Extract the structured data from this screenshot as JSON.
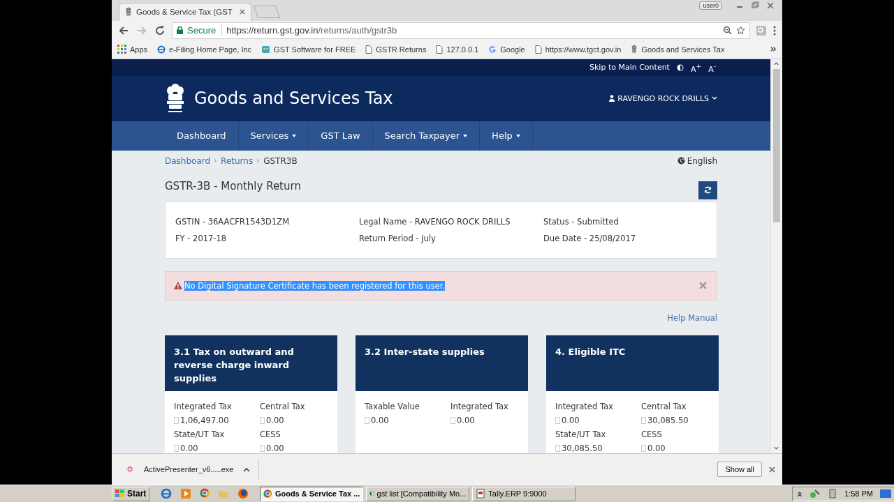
{
  "browser": {
    "tabs": [
      {
        "title": "Goods & Service Tax (GST",
        "selected": true
      }
    ],
    "profile": "user0",
    "url": {
      "secure_label": "Secure",
      "host": "https://return.gst.gov.in",
      "path": "/returns/auth/gstr3b"
    },
    "bookmarks": [
      {
        "label": "Apps",
        "kind": "apps"
      },
      {
        "label": "e-Filing Home Page, Inc",
        "kind": "ie"
      },
      {
        "label": "GST Software for FREE",
        "kind": "app"
      },
      {
        "label": "GSTR Returns",
        "kind": "page"
      },
      {
        "label": "127.0.0.1",
        "kind": "page"
      },
      {
        "label": "Google",
        "kind": "google"
      },
      {
        "label": "https://www.tgct.gov.in",
        "kind": "page"
      },
      {
        "label": "Goods and Services Tax",
        "kind": "emblem"
      }
    ]
  },
  "page": {
    "skip_link": "Skip to Main Content",
    "font_controls": [
      "A$^{+}$",
      "A$^{-}$"
    ],
    "site_title": "Goods and Services Tax",
    "user": "RAVENGO ROCK DRILLS",
    "nav": [
      {
        "label": "Dashboard",
        "dropdown": false
      },
      {
        "label": "Services",
        "dropdown": true
      },
      {
        "label": "GST Law",
        "dropdown": false
      },
      {
        "label": "Search Taxpayer",
        "dropdown": true
      },
      {
        "label": "Help",
        "dropdown": true
      }
    ],
    "breadcrumbs": [
      "Dashboard",
      "Returns",
      "GSTR3B"
    ],
    "language": "English",
    "heading": "GSTR-3B - Monthly Return",
    "info": [
      "GSTIN - 36AACFR1543D1ZM",
      "Legal Name - RAVENGO ROCK DRILLS",
      "Status - Submitted",
      "FY - 2017-18",
      "Return Period - July",
      "Due Date - 25/08/2017"
    ],
    "alert": {
      "message": "No Digital Signature Certificate has been registered for this user.",
      "text_selected": true
    },
    "help_link": "Help Manual",
    "tiles": [
      {
        "title": "3.1 Tax on outward and reverse charge inward supplies",
        "fields": [
          {
            "label": "Integrated Tax",
            "value": "1,06,497.00"
          },
          {
            "label": "Central Tax",
            "value": "0.00"
          },
          {
            "label": "State/UT Tax",
            "value": "0.00"
          },
          {
            "label": "CESS",
            "value": "0.00"
          }
        ]
      },
      {
        "title": "3.2 Inter-state supplies",
        "fields": [
          {
            "label": "Taxable Value",
            "value": "0.00"
          },
          {
            "label": "Integrated Tax",
            "value": "0.00"
          }
        ]
      },
      {
        "title": "4. Eligible ITC",
        "fields": [
          {
            "label": "Integrated Tax",
            "value": "0.00"
          },
          {
            "label": "Central Tax",
            "value": "30,085.50"
          },
          {
            "label": "State/UT Tax",
            "value": "30,085.50"
          },
          {
            "label": "CESS",
            "value": "0.00"
          }
        ]
      }
    ]
  },
  "downloads": {
    "items": [
      {
        "name": "ActivePresenter_v6.....exe"
      }
    ],
    "show_all": "Show all"
  },
  "taskbar": {
    "start": "Start",
    "tasks": [
      {
        "label": "Goods & Service Tax ...",
        "kind": "chrome",
        "selected": true
      },
      {
        "label": "gst list  [Compatibility Mo...",
        "kind": "excel",
        "selected": false
      },
      {
        "label": "Tally.ERP 9:9000",
        "kind": "tally",
        "selected": false
      }
    ],
    "clock": "1:58 PM"
  }
}
